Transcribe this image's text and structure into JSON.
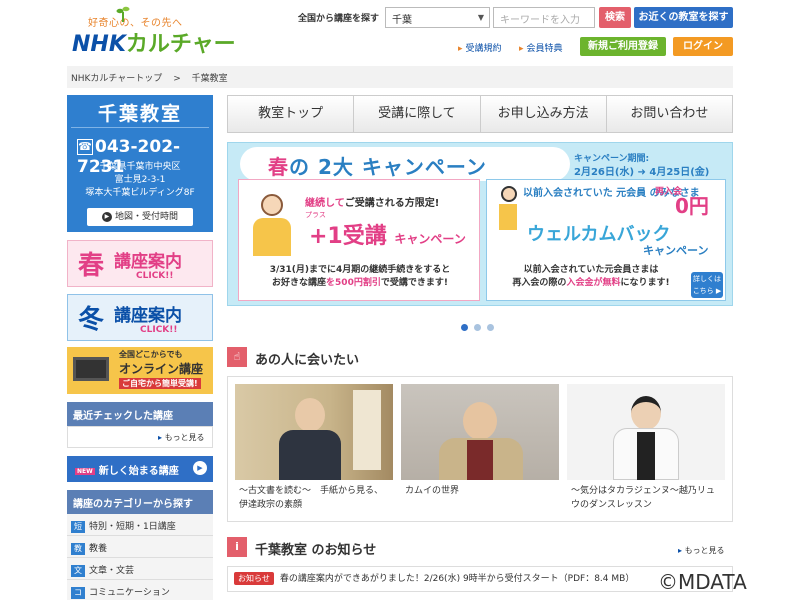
{
  "header": {
    "logo_tagline": "好奇心の、その先へ",
    "logo_nhk": "NHK",
    "logo_culture": "カルチャー",
    "search_label": "全国から講座を探す",
    "region_select_value": "千葉",
    "keyword_placeholder": "キーワードを入力",
    "search_button": "検索",
    "nearby_button": "お近くの教室を探す",
    "terms_link": "受講規約",
    "benefits_link": "会員特典",
    "register_button": "新規ご利用登録",
    "login_button": "ログイン"
  },
  "breadcrumb": {
    "items": [
      "NHKカルチャートップ",
      "千葉教室"
    ],
    "separator": ">"
  },
  "school": {
    "name": "千葉教室",
    "phone": "043-202-7231",
    "address_lines": [
      "千葉県千葉市中央区",
      "富士見2-3-1",
      "塚本大千葉ビルディング8F"
    ],
    "map_button": "地図・受付時間"
  },
  "banners": {
    "spring": {
      "char": "春",
      "text": "講座案内",
      "click": "CLICK!!"
    },
    "winter": {
      "char": "冬",
      "text": "講座案内",
      "click": "CLICK!!"
    },
    "online": {
      "line1": "全国どこからでも",
      "line2": "オンライン講座",
      "line3": "ご自宅から簡単受講!"
    }
  },
  "sidebar": {
    "recent_title": "最近チェックした講座",
    "recent_more": "もっと見る",
    "new_courses": "新しく始まる講座",
    "new_badge": "NEW",
    "category_title": "講座のカテゴリーから探す",
    "categories": [
      {
        "icon": "短",
        "label": "特別・短期・1日講座"
      },
      {
        "icon": "教",
        "label": "教養"
      },
      {
        "icon": "文",
        "label": "文章・文芸"
      },
      {
        "icon": "コ",
        "label": "コミュニケーション"
      }
    ]
  },
  "nav": {
    "items": [
      "教室トップ",
      "受講に際して",
      "お申し込み方法",
      "お問い合わせ"
    ]
  },
  "campaign": {
    "title_haru": "春",
    "title_rest": "の 2大 キャンペーン",
    "period_label": "キャンペーン期間:",
    "period": "2月26日(水) ➜ 4月25日(金)",
    "left_sub_em": "継続して",
    "left_sub": "ご受講される方限定!",
    "left_plus": "プラス",
    "left_big": "+1受講",
    "left_big_small": "キャンペーン",
    "left_note_1": "3/31(月)までに4月期の継続手続きをすると",
    "left_note_2a": "お好きな講座",
    "left_note_2b": "を500円割引",
    "left_note_2c": "で受講できます!",
    "right_sub": "以前入会されていた 元会員 のみなさま",
    "right_price_label": "再入会",
    "right_price": "0円",
    "right_big": "ウェルカムバック",
    "right_camp": "キャンペーン",
    "right_note_1": "以前入会されていた元会員さまは",
    "right_note_2a": "再入会の際の",
    "right_note_2b": "入会金が無料",
    "right_note_2c": "になります!",
    "detail_button_1": "詳しくは",
    "detail_button_2": "こちら ▶"
  },
  "people_section": {
    "icon": "☝",
    "title": "あの人に会いたい",
    "cards": [
      {
        "caption": "～古文書を読む～　手紙から見る、伊達政宗の素顔"
      },
      {
        "caption": "カムイの世界"
      },
      {
        "caption": "～気分はタカラジェンヌ～越乃リュウのダンスレッスン"
      }
    ]
  },
  "notice_section": {
    "icon": "i",
    "title": "千葉教室 のお知らせ",
    "more": "もっと見る",
    "badge": "お知らせ",
    "first_notice": "春の講座案内ができあがりました！2/26(水) 9時半から受付スタート（PDF：8.4 MB）"
  },
  "carousel": {
    "count": 3,
    "active_index": 0
  },
  "watermark": "©MDATA",
  "colors": {
    "brand_blue": "#2f6fc6",
    "brand_green": "#6cb42d",
    "accent_pink": "#e23f86",
    "accent_orange": "#f39a23",
    "search_red": "#e35f6b"
  }
}
